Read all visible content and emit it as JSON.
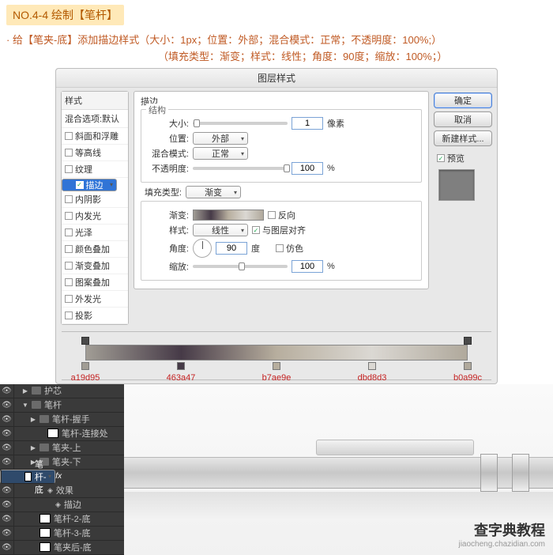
{
  "header": {
    "badge": "NO.4-4 绘制【笔杆】"
  },
  "desc_line1": "· 给【笔夹-底】添加描边样式（大小：1px；位置：外部；混合模式：正常；不透明度：100%;）",
  "desc_line2": "（填充类型：渐变；样式：线性；角度：90度；缩放：100%；）",
  "dialog": {
    "title": "图层样式",
    "styles_header": "样式",
    "styles_sub": "混合选项:默认",
    "styles": [
      {
        "label": "斜面和浮雕",
        "checked": false
      },
      {
        "label": "等高线",
        "checked": false
      },
      {
        "label": "纹理",
        "checked": false
      },
      {
        "label": "描边",
        "checked": true,
        "selected": true
      },
      {
        "label": "内阴影",
        "checked": false
      },
      {
        "label": "内发光",
        "checked": false
      },
      {
        "label": "光泽",
        "checked": false
      },
      {
        "label": "颜色叠加",
        "checked": false
      },
      {
        "label": "渐变叠加",
        "checked": false
      },
      {
        "label": "图案叠加",
        "checked": false
      },
      {
        "label": "外发光",
        "checked": false
      },
      {
        "label": "投影",
        "checked": false
      }
    ],
    "stroke": {
      "title": "描边",
      "structure_label": "结构",
      "size_label": "大小:",
      "size_value": "1",
      "size_unit": "像素",
      "position_label": "位置:",
      "position_value": "外部",
      "blend_label": "混合模式:",
      "blend_value": "正常",
      "opacity_label": "不透明度:",
      "opacity_value": "100",
      "opacity_unit": "%",
      "fill_type_label": "填充类型:",
      "fill_type_value": "渐变",
      "gradient_label": "渐变:",
      "reverse_label": "反向",
      "style_label": "样式:",
      "style_value": "线性",
      "align_label": "与图层对齐",
      "angle_label": "角度:",
      "angle_value": "90",
      "angle_unit": "度",
      "dither_label": "仿色",
      "scale_label": "缩放:",
      "scale_value": "100",
      "scale_unit": "%"
    },
    "buttons": {
      "ok": "确定",
      "cancel": "取消",
      "new_style": "新建样式...",
      "preview": "预览"
    }
  },
  "gradient": {
    "stops": [
      {
        "pos": 0,
        "hex": "a19d95"
      },
      {
        "pos": 25,
        "hex": "463a47"
      },
      {
        "pos": 50,
        "hex": "b7ae9e"
      },
      {
        "pos": 75,
        "hex": "dbd8d3"
      },
      {
        "pos": 100,
        "hex": "b0a99c"
      }
    ]
  },
  "layers": [
    {
      "label": "护芯",
      "type": "folder",
      "depth": 1,
      "open": false
    },
    {
      "label": "笔杆",
      "type": "folder",
      "depth": 1,
      "open": true
    },
    {
      "label": "笔杆-握手",
      "type": "folder",
      "depth": 2,
      "open": false
    },
    {
      "label": "笔杆-连接处",
      "type": "layer",
      "depth": 3
    },
    {
      "label": "笔夹-上",
      "type": "folder",
      "depth": 2,
      "open": false
    },
    {
      "label": "笔夹-下",
      "type": "folder",
      "depth": 2,
      "open": false
    },
    {
      "label": "笔杆-底",
      "type": "layer",
      "depth": 2,
      "selected": true,
      "fx": "fx"
    },
    {
      "label": "效果",
      "type": "fx",
      "depth": 3
    },
    {
      "label": "描边",
      "type": "fx",
      "depth": 4
    },
    {
      "label": "笔杆-2-底",
      "type": "layer",
      "depth": 2
    },
    {
      "label": "笔杆-3-底",
      "type": "layer",
      "depth": 2
    },
    {
      "label": "笔夹后-底",
      "type": "layer",
      "depth": 2
    }
  ],
  "watermark": {
    "main": "查字典教程",
    "url": "jiaocheng.chazidian.com"
  }
}
